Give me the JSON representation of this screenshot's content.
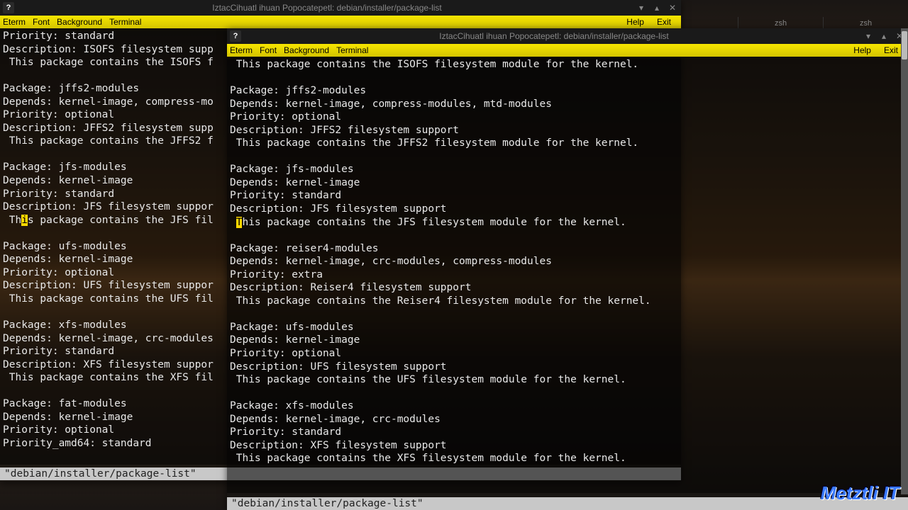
{
  "window_title": "IztacCihuatl ihuan Popocatepetl: debian/installer/package-list",
  "menubar": {
    "eterm": "Eterm",
    "font": "Font",
    "background": "Background",
    "terminal": "Terminal",
    "help": "Help",
    "exit": "Exit"
  },
  "win_icon": "?",
  "tabs": {
    "zsh1": "zsh",
    "zsh2": "zsh"
  },
  "back_term": {
    "lines": [
      "Priority: standard",
      "Description: ISOFS filesystem supp",
      " This package contains the ISOFS f",
      "",
      "Package: jffs2-modules",
      "Depends: kernel-image, compress-mo",
      "Priority: optional",
      "Description: JFFS2 filesystem supp",
      " This package contains the JFFS2 f",
      "",
      "Package: jfs-modules",
      "Depends: kernel-image",
      "Priority: standard",
      "Description: JFS filesystem suppor",
      " This package contains the JFS fil",
      "",
      "Package: ufs-modules",
      "Depends: kernel-image",
      "Priority: optional",
      "Description: UFS filesystem suppor",
      " This package contains the UFS fil",
      "",
      "Package: xfs-modules",
      "Depends: kernel-image, crc-modules",
      "Priority: standard",
      "Description: XFS filesystem suppor",
      " This package contains the XFS fil",
      "",
      "Package: fat-modules",
      "Depends: kernel-image",
      "Priority: optional",
      "Priority_amd64: standard"
    ],
    "status": "\"debian/installer/package-list\"",
    "cursor_line_before": " Th",
    "cursor_char": "i",
    "cursor_line_after": "s package contains the JFS fil"
  },
  "front_term": {
    "lines_before_cursor": [
      " This package contains the ISOFS filesystem module for the kernel.",
      "",
      "Package: jffs2-modules",
      "Depends: kernel-image, compress-modules, mtd-modules",
      "Priority: optional",
      "Description: JFFS2 filesystem support",
      " This package contains the JFFS2 filesystem module for the kernel.",
      "",
      "Package: jfs-modules",
      "Depends: kernel-image",
      "Priority: standard",
      "Description: JFS filesystem support"
    ],
    "cursor_line_before": " ",
    "cursor_char": "T",
    "cursor_line_after": "his package contains the JFS filesystem module for the kernel.",
    "lines_after_cursor": [
      "",
      "Package: reiser4-modules",
      "Depends: kernel-image, crc-modules, compress-modules",
      "Priority: extra",
      "Description: Reiser4 filesystem support",
      " This package contains the Reiser4 filesystem module for the kernel.",
      "",
      "Package: ufs-modules",
      "Depends: kernel-image",
      "Priority: optional",
      "Description: UFS filesystem support",
      " This package contains the UFS filesystem module for the kernel.",
      "",
      "Package: xfs-modules",
      "Depends: kernel-image, crc-modules",
      "Priority: standard",
      "Description: XFS filesystem support",
      " This package contains the XFS filesystem module for the kernel.",
      ""
    ],
    "status": "\"debian/installer/package-list\""
  },
  "watermark": "Metztli IT"
}
